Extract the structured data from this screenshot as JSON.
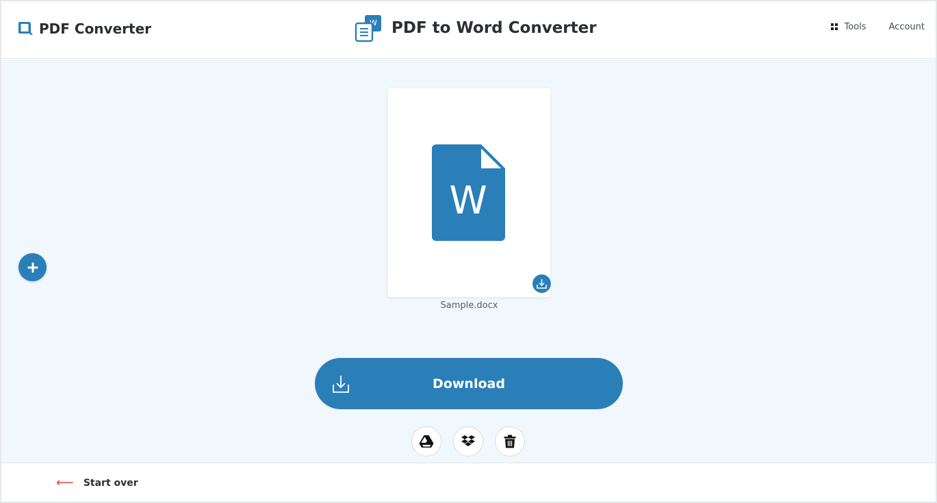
{
  "header": {
    "brand": "PDF Converter",
    "page_title": "PDF to Word Converter",
    "nav": [
      {
        "label": "Tools",
        "icon": "grid-icon"
      },
      {
        "label": "Account"
      }
    ]
  },
  "file": {
    "name": "Sample.docx",
    "icon_letter": "W",
    "icon": "word-document-icon"
  },
  "actions": {
    "download_label": "Download",
    "cloud_buttons": [
      "google-drive-icon",
      "dropbox-icon",
      "trash-icon"
    ]
  },
  "footer": {
    "start_over_arrow": "⟵",
    "start_over_label": "Start over"
  },
  "colors": {
    "accent": "#2a7fb8",
    "background": "#f0f7fd",
    "danger": "#e04a3a"
  }
}
